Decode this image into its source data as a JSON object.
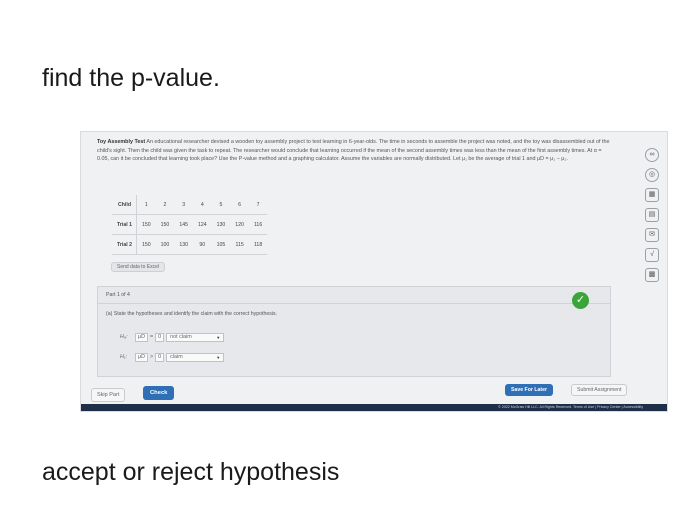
{
  "captions": {
    "top": "find the p-value.",
    "bottom": "accept or reject hypothesis"
  },
  "problem": {
    "title": "Toy Assembly Test",
    "text": "An educational researcher devised a wooden toy assembly project to test learning in 6-year-olds. The time in seconds to assemble the project was noted, and the toy was disassembled out of the child's sight. Then the child was given the task to repeat. The researcher would conclude that learning occurred if the mean of the second assembly times was less than the mean of the first assembly times. At α = 0.05, can it be concluded that learning took place? Use the P-value method and a graphing calculator. Assume the variables are normally distributed. Let μ₁ be the average of trial 1 and μD = μ₁ − μ₂."
  },
  "table": {
    "header_label": "Child",
    "children": [
      "1",
      "2",
      "3",
      "4",
      "5",
      "6",
      "7"
    ],
    "rows": [
      {
        "label": "Trial 1",
        "values": [
          "150",
          "150",
          "145",
          "124",
          "130",
          "120",
          "116"
        ]
      },
      {
        "label": "Trial 2",
        "values": [
          "150",
          "100",
          "130",
          "90",
          "105",
          "115",
          "118"
        ]
      }
    ]
  },
  "send_button": "Send data to Excel",
  "part": {
    "label": "Part 1 of 4",
    "question": "(a) State the hypotheses and identify the claim with the correct hypothesis.",
    "h0": {
      "symbol": "H₀:",
      "mu": "μD",
      "op": "=",
      "value": "0",
      "claim": "not claim"
    },
    "h1": {
      "symbol": "H₁:",
      "mu": "μD",
      "op": ">",
      "value": "0",
      "claim": "claim"
    }
  },
  "buttons": {
    "skip": "Skip Part",
    "check": "Check",
    "save": "Save For Later",
    "submit": "Submit Assignment"
  },
  "footer": "© 2022 McGraw Hill LLC. All Rights Reserved.   Terms of Use  |  Privacy Center  |  Accessibility",
  "tools": [
    "infinity-icon",
    "target-icon",
    "calculator-icon",
    "book-icon",
    "mail-icon",
    "math-icon",
    "grid-icon"
  ],
  "colors": {
    "check": "#3aa63a",
    "primary": "#2f6fb5",
    "footer": "#1f2f4a"
  }
}
